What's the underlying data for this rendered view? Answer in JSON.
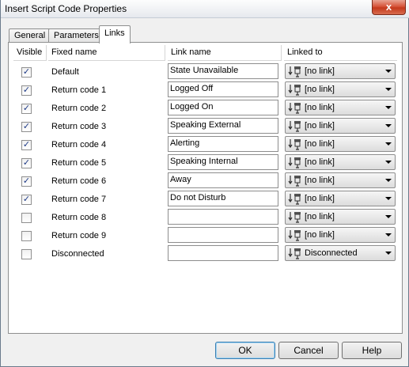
{
  "window": {
    "title": "Insert Script Code Properties",
    "close_glyph": "x"
  },
  "tabs": [
    {
      "label": "General"
    },
    {
      "label": "Parameters"
    },
    {
      "label": "Links"
    }
  ],
  "columns": {
    "visible": "Visible",
    "fixed": "Fixed name",
    "link": "Link name",
    "linked": "Linked to"
  },
  "rows": [
    {
      "visible": true,
      "fixed": "Default",
      "link": "State Unavailable",
      "linked": "[no link]"
    },
    {
      "visible": true,
      "fixed": "Return code 1",
      "link": "Logged Off",
      "linked": "[no link]"
    },
    {
      "visible": true,
      "fixed": "Return code 2",
      "link": "Logged On",
      "linked": "[no link]"
    },
    {
      "visible": true,
      "fixed": "Return code 3",
      "link": "Speaking External",
      "linked": "[no link]"
    },
    {
      "visible": true,
      "fixed": "Return code 4",
      "link": "Alerting",
      "linked": "[no link]"
    },
    {
      "visible": true,
      "fixed": "Return code 5",
      "link": "Speaking Internal",
      "linked": "[no link]"
    },
    {
      "visible": true,
      "fixed": "Return code 6",
      "link": "Away",
      "linked": "[no link]"
    },
    {
      "visible": true,
      "fixed": "Return code 7",
      "link": "Do not Disturb",
      "linked": "[no link]"
    },
    {
      "visible": false,
      "fixed": "Return code 8",
      "link": "",
      "linked": "[no link]"
    },
    {
      "visible": false,
      "fixed": "Return code 9",
      "link": "",
      "linked": "[no link]"
    },
    {
      "visible": false,
      "fixed": "Disconnected",
      "link": "",
      "linked": "Disconnected"
    }
  ],
  "buttons": {
    "ok": "OK",
    "cancel": "Cancel",
    "help": "Help"
  },
  "icons": {
    "check": "✓",
    "link_icon": "link-target-icon",
    "dropdown": "chevron-down-icon"
  }
}
